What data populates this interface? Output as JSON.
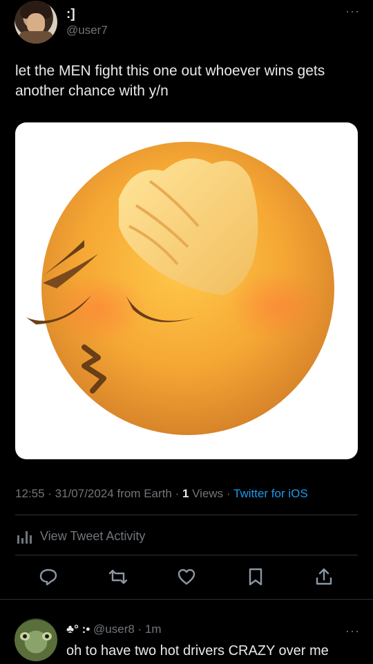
{
  "tweet": {
    "author_name": ":]",
    "author_handle": "@user7",
    "more_label": "···",
    "text": "let the MEN fight this one out whoever wins gets another chance with y/n",
    "media_emoji_name": "face-palm-emoji",
    "time": "12:55",
    "sep1": " · ",
    "date": "31/07/2024",
    "source_prefix": " from Earth",
    "sep2": " · ",
    "views_count": "1",
    "views_label": " Views",
    "sep3": " · ",
    "client": "Twitter for iOS"
  },
  "activity": {
    "label": "View Tweet Activity"
  },
  "actions": [
    "reply-icon",
    "retweet-icon",
    "like-icon",
    "bookmark-icon",
    "share-icon"
  ],
  "reply": {
    "author_name": "♣︎° :•",
    "author_handle": "@user8",
    "separator": " · ",
    "time": "1m",
    "more_label": "···",
    "text": "oh to have two hot drivers CRAZY over me"
  },
  "colors": {
    "background": "#000000",
    "text": "#e7e9ea",
    "muted": "#71767b",
    "link": "#1d9bf0",
    "divider": "#2f3336"
  }
}
